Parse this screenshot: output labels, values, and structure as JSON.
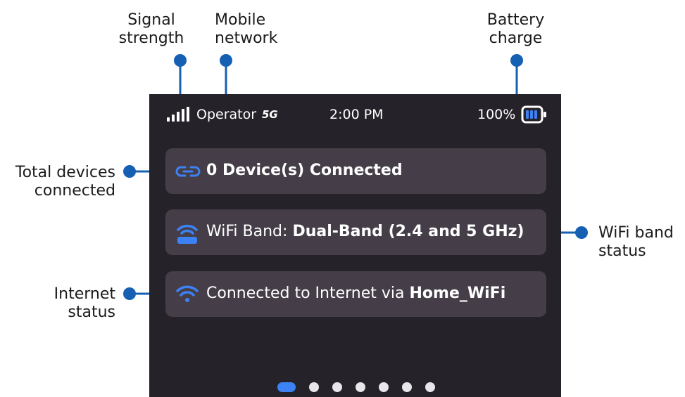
{
  "callouts": {
    "signal": [
      "Signal",
      "strength"
    ],
    "mobile": [
      "Mobile",
      "network"
    ],
    "battery": [
      "Battery",
      "charge"
    ],
    "devices": [
      "Total devices",
      "connected"
    ],
    "wifi_band": [
      "WiFi band",
      "status"
    ],
    "internet": [
      "Internet",
      "status"
    ]
  },
  "status_bar": {
    "operator": "Operator",
    "network_type": "5G",
    "time": "2:00 PM",
    "battery_percent": "100%",
    "signal_level": 1.0,
    "battery_level": 1.0
  },
  "cards": {
    "devices": {
      "icon": "link-icon",
      "text": "0 Device(s) Connected"
    },
    "wifi_band": {
      "icon": "router-icon",
      "prefix": "WiFi Band: ",
      "value": "Dual-Band (2.4 and 5 GHz)"
    },
    "internet": {
      "icon": "wifi-icon",
      "prefix": "Connected to Internet via ",
      "value": "Home_WiFi"
    }
  },
  "pager": {
    "total": 7,
    "active_index": 0
  },
  "colors": {
    "screen_bg": "#262229",
    "card_bg": "#453e48",
    "accent": "#3d82f5",
    "callout_line": "#1560b3"
  }
}
